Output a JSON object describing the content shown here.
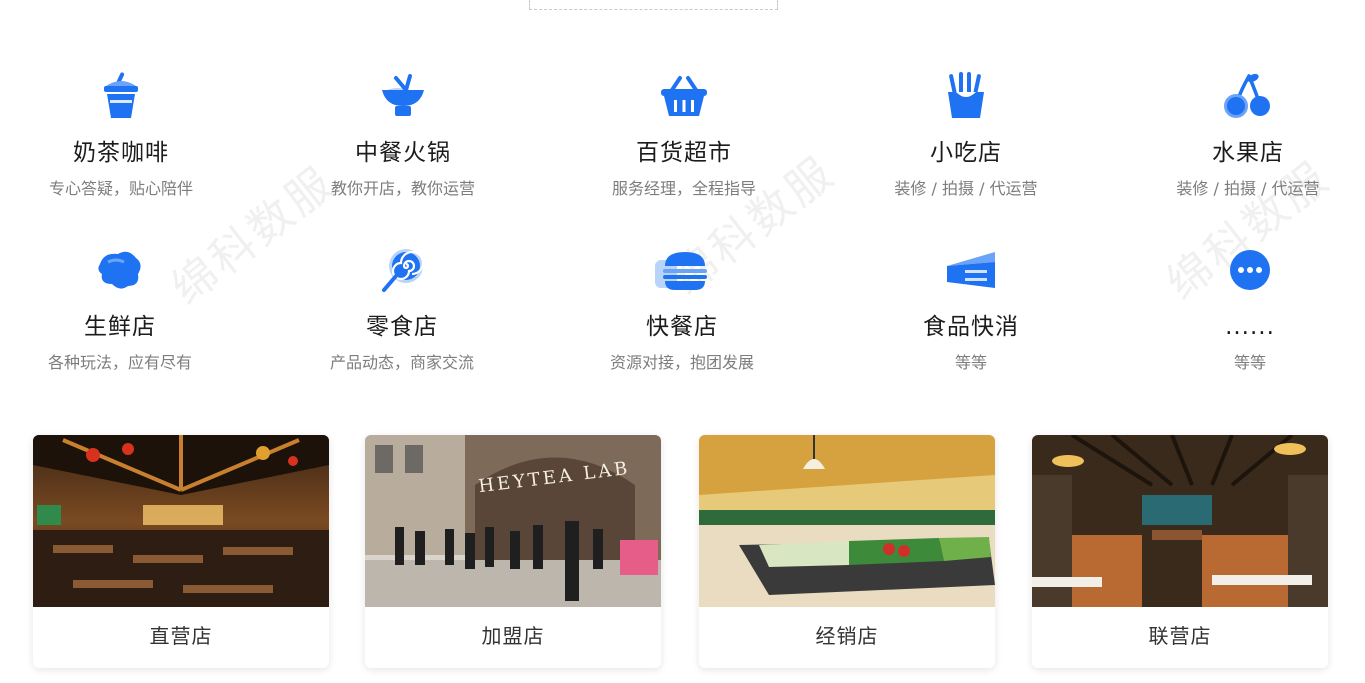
{
  "categories": [
    {
      "title": "奶茶咖啡",
      "sub": "专心答疑，贴心陪伴",
      "icon": "milk-tea-icon"
    },
    {
      "title": "中餐火锅",
      "sub": "教你开店，教你运营",
      "icon": "chinese-food-icon"
    },
    {
      "title": "百货超市",
      "sub": "服务经理，全程指导",
      "icon": "shopping-basket-icon"
    },
    {
      "title": "小吃店",
      "sub": "装修 / 拍摄 / 代运营",
      "icon": "fries-icon"
    },
    {
      "title": "水果店",
      "sub": "装修 / 拍摄 / 代运营",
      "icon": "cherry-icon"
    },
    {
      "title": "生鲜店",
      "sub": "各种玩法，应有尽有",
      "icon": "fresh-produce-icon"
    },
    {
      "title": "零食店",
      "sub": "产品动态，商家交流",
      "icon": "lollipop-icon"
    },
    {
      "title": "快餐店",
      "sub": "资源对接，抱团发展",
      "icon": "burger-icon"
    },
    {
      "title": "食品快消",
      "sub": "等等",
      "icon": "cake-slice-icon"
    },
    {
      "title": "......",
      "sub": "等等",
      "icon": "more-icon"
    }
  ],
  "store_types": [
    {
      "label": "直营店",
      "photo": "restaurant-interior-photo"
    },
    {
      "label": "加盟店",
      "photo": "storefront-queue-photo",
      "sign_text": "HEYTEA LAB"
    },
    {
      "label": "经销店",
      "photo": "supermarket-produce-photo"
    },
    {
      "label": "联营店",
      "photo": "dining-booths-photo"
    }
  ],
  "watermark": "绵科数服",
  "colors": {
    "accent": "#1f72f2",
    "accent_light": "#b9d4fb"
  }
}
